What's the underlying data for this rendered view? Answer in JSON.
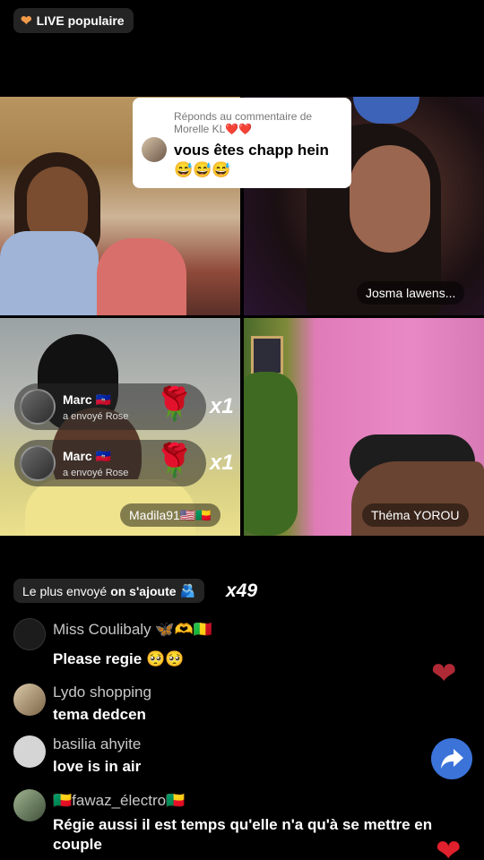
{
  "live_badge": {
    "icon": "heart-icon",
    "label": "LIVE populaire"
  },
  "reply": {
    "header": "Réponds au commentaire de Morelle KL",
    "header_hearts": "❤️❤️",
    "text": "vous êtes chapp hein😅😅😅"
  },
  "tiles": [
    {
      "name": ""
    },
    {
      "name": "Josma lawens..."
    },
    {
      "name": "Madila91🇺🇸🇧🇯"
    },
    {
      "name": "Théma YOROU"
    }
  ],
  "gifts": [
    {
      "sender": "Marc 🇭🇹",
      "subtitle": "a envoyé  Rose",
      "emoji": "🌹",
      "count": "x1"
    },
    {
      "sender": "Marc 🇭🇹",
      "subtitle": "a envoyé  Rose",
      "emoji": "🌹",
      "count": "x1"
    }
  ],
  "most_sent": {
    "label": "Le plus envoyé",
    "action": "on s'ajoute",
    "emoji": "🫂",
    "count": "x49"
  },
  "comments": [
    {
      "name": "Miss Coulibaly 🦋🫶🇲🇱",
      "text": "Please regie 🥺🥺"
    },
    {
      "name": "Lydo shopping",
      "text": "tema dedcen"
    },
    {
      "name": "basilia ahyite",
      "text": "love is in air"
    },
    {
      "name": "🇧🇯fawaz_électro🇧🇯",
      "text": "Régie aussi il est temps qu'elle n'a qu'à se mettre en couple"
    }
  ],
  "colors": {
    "accent_blue": "#3b73d9",
    "heart_red": "#b02a35",
    "badge_bg": "#262626"
  }
}
